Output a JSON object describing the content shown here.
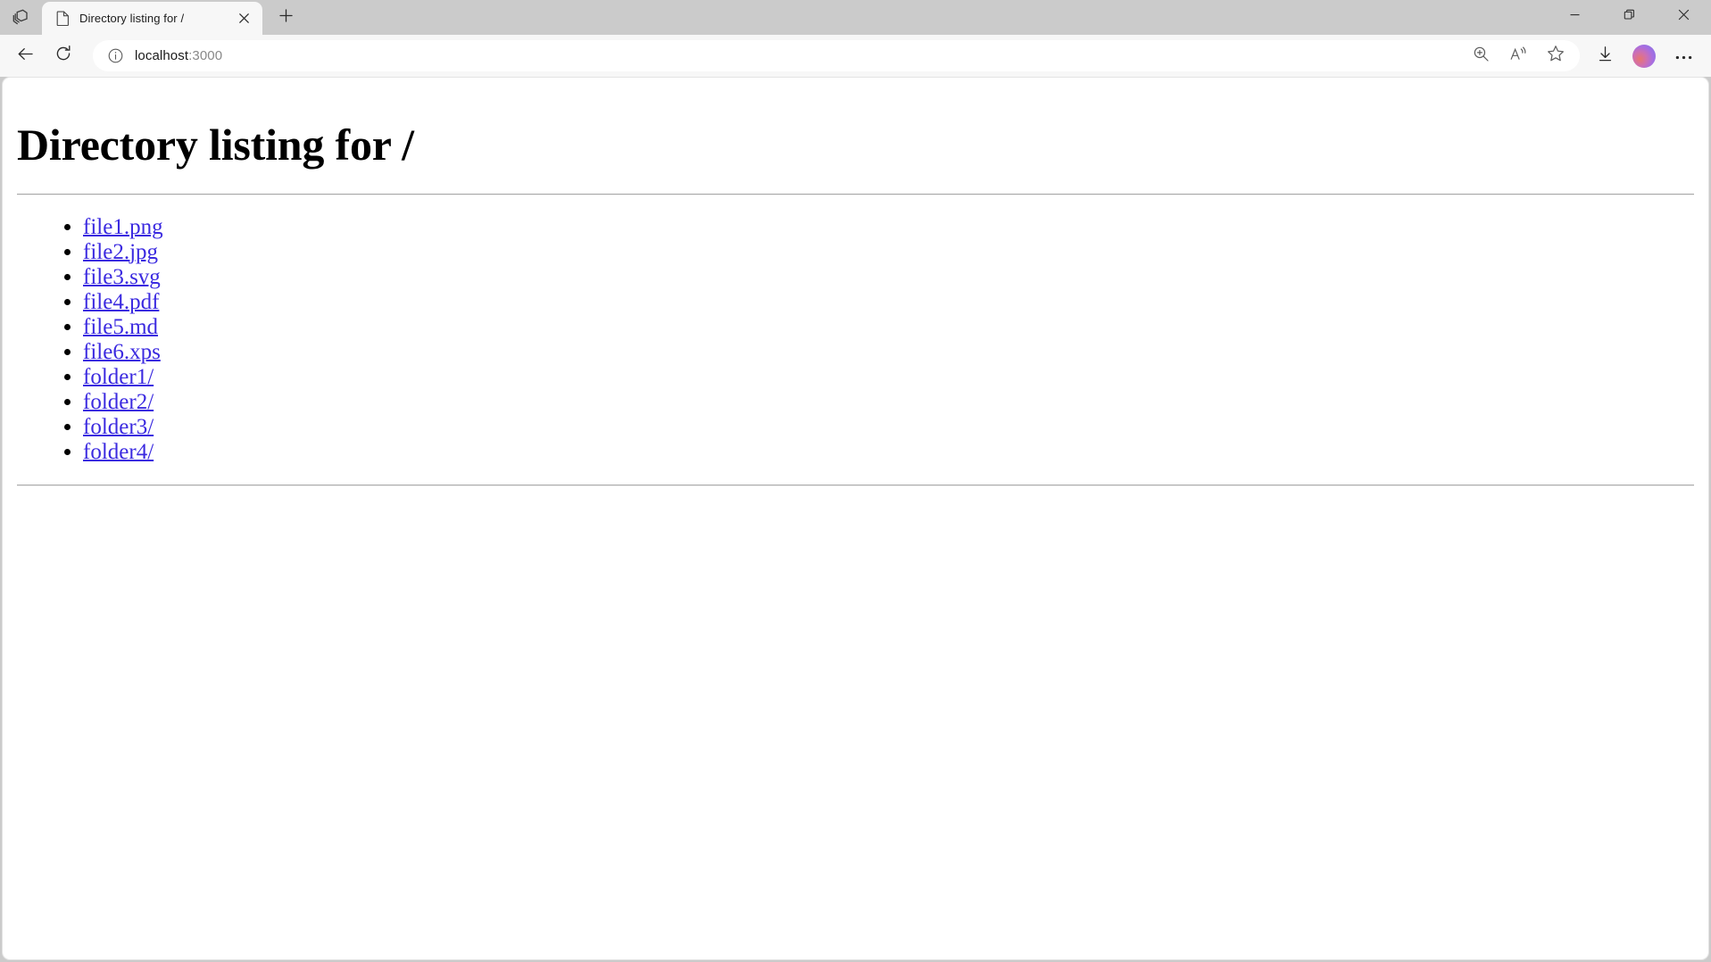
{
  "browser": {
    "tab_actions_icon": "stacked-tabs-icon",
    "tab": {
      "favicon": "document-icon",
      "title": "Directory listing for /",
      "close_icon": "close-icon"
    },
    "new_tab_icon": "plus-icon",
    "window_controls": {
      "minimize_icon": "minimize-icon",
      "restore_icon": "restore-icon",
      "close_icon": "close-icon"
    },
    "nav": {
      "back_icon": "back-arrow-icon",
      "refresh_icon": "refresh-icon"
    },
    "address": {
      "site_info_icon": "info-circle-icon",
      "host": "localhost",
      "port": ":3000",
      "placeholder": "Search or enter web address"
    },
    "address_actions": [
      {
        "name": "zoom-in-icon",
        "label": "Zoom in"
      },
      {
        "name": "read-aloud-icon",
        "label": "Read aloud"
      },
      {
        "name": "favorite-star-icon",
        "label": "Add this page to favorites"
      }
    ],
    "toolbar": [
      {
        "name": "downloads-icon",
        "label": "Downloads"
      },
      {
        "name": "profile-avatar",
        "label": "Profile"
      },
      {
        "name": "settings-more-icon",
        "label": "Settings and more"
      }
    ]
  },
  "page": {
    "title": "Directory listing for /",
    "entries": [
      {
        "label": "file1.png"
      },
      {
        "label": "file2.jpg"
      },
      {
        "label": "file3.svg"
      },
      {
        "label": "file4.pdf"
      },
      {
        "label": "file5.md"
      },
      {
        "label": "file6.xps"
      },
      {
        "label": "folder1/"
      },
      {
        "label": "folder2/"
      },
      {
        "label": "folder3/"
      },
      {
        "label": "folder4/"
      }
    ]
  },
  "colors": {
    "link": "#3b2ae0",
    "chrome_bg": "#cbcbcb",
    "toolbar_bg": "#f7f7f7",
    "page_bg": "#ffffff",
    "url_port": "#888888"
  }
}
